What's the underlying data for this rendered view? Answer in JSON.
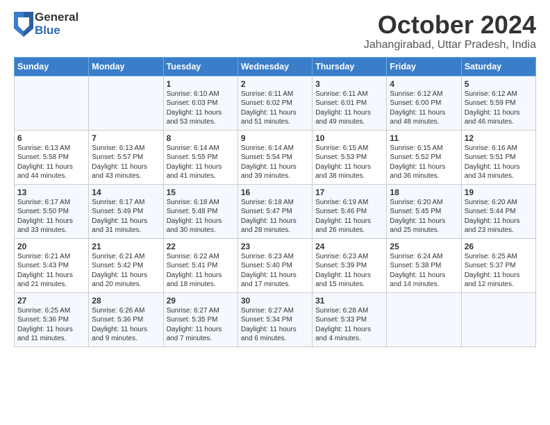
{
  "logo": {
    "general": "General",
    "blue": "Blue"
  },
  "title": "October 2024",
  "location": "Jahangirabad, Uttar Pradesh, India",
  "days_of_week": [
    "Sunday",
    "Monday",
    "Tuesday",
    "Wednesday",
    "Thursday",
    "Friday",
    "Saturday"
  ],
  "weeks": [
    [
      {
        "day": "",
        "content": ""
      },
      {
        "day": "",
        "content": ""
      },
      {
        "day": "1",
        "content": "Sunrise: 6:10 AM\nSunset: 6:03 PM\nDaylight: 11 hours and 53 minutes."
      },
      {
        "day": "2",
        "content": "Sunrise: 6:11 AM\nSunset: 6:02 PM\nDaylight: 11 hours and 51 minutes."
      },
      {
        "day": "3",
        "content": "Sunrise: 6:11 AM\nSunset: 6:01 PM\nDaylight: 11 hours and 49 minutes."
      },
      {
        "day": "4",
        "content": "Sunrise: 6:12 AM\nSunset: 6:00 PM\nDaylight: 11 hours and 48 minutes."
      },
      {
        "day": "5",
        "content": "Sunrise: 6:12 AM\nSunset: 5:59 PM\nDaylight: 11 hours and 46 minutes."
      }
    ],
    [
      {
        "day": "6",
        "content": "Sunrise: 6:13 AM\nSunset: 5:58 PM\nDaylight: 11 hours and 44 minutes."
      },
      {
        "day": "7",
        "content": "Sunrise: 6:13 AM\nSunset: 5:57 PM\nDaylight: 11 hours and 43 minutes."
      },
      {
        "day": "8",
        "content": "Sunrise: 6:14 AM\nSunset: 5:55 PM\nDaylight: 11 hours and 41 minutes."
      },
      {
        "day": "9",
        "content": "Sunrise: 6:14 AM\nSunset: 5:54 PM\nDaylight: 11 hours and 39 minutes."
      },
      {
        "day": "10",
        "content": "Sunrise: 6:15 AM\nSunset: 5:53 PM\nDaylight: 11 hours and 38 minutes."
      },
      {
        "day": "11",
        "content": "Sunrise: 6:15 AM\nSunset: 5:52 PM\nDaylight: 11 hours and 36 minutes."
      },
      {
        "day": "12",
        "content": "Sunrise: 6:16 AM\nSunset: 5:51 PM\nDaylight: 11 hours and 34 minutes."
      }
    ],
    [
      {
        "day": "13",
        "content": "Sunrise: 6:17 AM\nSunset: 5:50 PM\nDaylight: 11 hours and 33 minutes."
      },
      {
        "day": "14",
        "content": "Sunrise: 6:17 AM\nSunset: 5:49 PM\nDaylight: 11 hours and 31 minutes."
      },
      {
        "day": "15",
        "content": "Sunrise: 6:18 AM\nSunset: 5:48 PM\nDaylight: 11 hours and 30 minutes."
      },
      {
        "day": "16",
        "content": "Sunrise: 6:18 AM\nSunset: 5:47 PM\nDaylight: 11 hours and 28 minutes."
      },
      {
        "day": "17",
        "content": "Sunrise: 6:19 AM\nSunset: 5:46 PM\nDaylight: 11 hours and 26 minutes."
      },
      {
        "day": "18",
        "content": "Sunrise: 6:20 AM\nSunset: 5:45 PM\nDaylight: 11 hours and 25 minutes."
      },
      {
        "day": "19",
        "content": "Sunrise: 6:20 AM\nSunset: 5:44 PM\nDaylight: 11 hours and 23 minutes."
      }
    ],
    [
      {
        "day": "20",
        "content": "Sunrise: 6:21 AM\nSunset: 5:43 PM\nDaylight: 11 hours and 21 minutes."
      },
      {
        "day": "21",
        "content": "Sunrise: 6:21 AM\nSunset: 5:42 PM\nDaylight: 11 hours and 20 minutes."
      },
      {
        "day": "22",
        "content": "Sunrise: 6:22 AM\nSunset: 5:41 PM\nDaylight: 11 hours and 18 minutes."
      },
      {
        "day": "23",
        "content": "Sunrise: 6:23 AM\nSunset: 5:40 PM\nDaylight: 11 hours and 17 minutes."
      },
      {
        "day": "24",
        "content": "Sunrise: 6:23 AM\nSunset: 5:39 PM\nDaylight: 11 hours and 15 minutes."
      },
      {
        "day": "25",
        "content": "Sunrise: 6:24 AM\nSunset: 5:38 PM\nDaylight: 11 hours and 14 minutes."
      },
      {
        "day": "26",
        "content": "Sunrise: 6:25 AM\nSunset: 5:37 PM\nDaylight: 11 hours and 12 minutes."
      }
    ],
    [
      {
        "day": "27",
        "content": "Sunrise: 6:25 AM\nSunset: 5:36 PM\nDaylight: 11 hours and 11 minutes."
      },
      {
        "day": "28",
        "content": "Sunrise: 6:26 AM\nSunset: 5:36 PM\nDaylight: 11 hours and 9 minutes."
      },
      {
        "day": "29",
        "content": "Sunrise: 6:27 AM\nSunset: 5:35 PM\nDaylight: 11 hours and 7 minutes."
      },
      {
        "day": "30",
        "content": "Sunrise: 6:27 AM\nSunset: 5:34 PM\nDaylight: 11 hours and 6 minutes."
      },
      {
        "day": "31",
        "content": "Sunrise: 6:28 AM\nSunset: 5:33 PM\nDaylight: 11 hours and 4 minutes."
      },
      {
        "day": "",
        "content": ""
      },
      {
        "day": "",
        "content": ""
      }
    ]
  ]
}
